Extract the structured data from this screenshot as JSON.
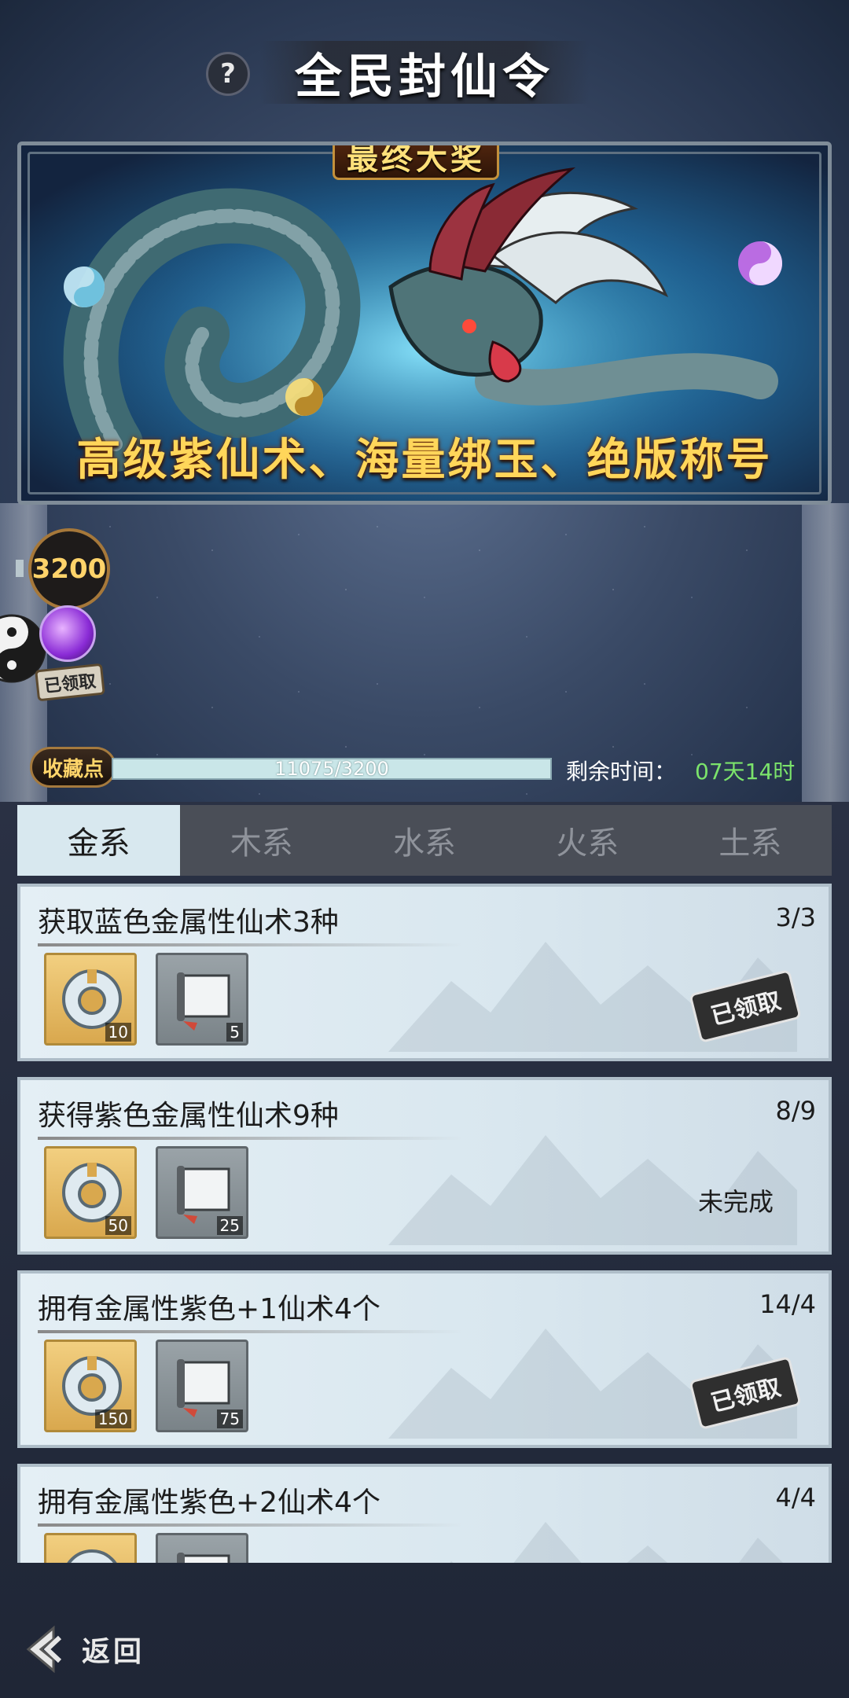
{
  "header": {
    "title": "全民封仙令",
    "help_label": "?"
  },
  "banner": {
    "prize_tag": "最终大奖",
    "reward_text": "高级紫仙术、海量绑玉、绝版称号"
  },
  "milestone": {
    "value": "3200",
    "claimed_label": "已领取"
  },
  "progress": {
    "label": "收藏点",
    "text": "11075/3200",
    "fraction": 1.0,
    "time_label": "剩余时间：",
    "time_value": "07天14时"
  },
  "tabs": [
    {
      "label": "金系",
      "active": true
    },
    {
      "label": "木系",
      "active": false
    },
    {
      "label": "水系",
      "active": false
    },
    {
      "label": "火系",
      "active": false
    },
    {
      "label": "土系",
      "active": false
    }
  ],
  "tasks": [
    {
      "title": "获取蓝色金属性仙术3种",
      "progress": "3/3",
      "rewards": [
        "10",
        "5"
      ],
      "status": "已领取",
      "claimed": true
    },
    {
      "title": "获得紫色金属性仙术9种",
      "progress": "8/9",
      "rewards": [
        "50",
        "25"
      ],
      "status": "未完成",
      "claimed": false
    },
    {
      "title": "拥有金属性紫色+1仙术4个",
      "progress": "14/4",
      "rewards": [
        "150",
        "75"
      ],
      "status": "已领取",
      "claimed": true
    },
    {
      "title": "拥有金属性紫色+2仙术4个",
      "progress": "4/4",
      "rewards": [
        "",
        ""
      ],
      "status": "",
      "claimed": true
    }
  ],
  "footer": {
    "back_label": "返回"
  },
  "colors": {
    "accent_gold": "#ffd65a",
    "time_green": "#7be36b",
    "tab_active_bg": "#d8e8ef"
  }
}
